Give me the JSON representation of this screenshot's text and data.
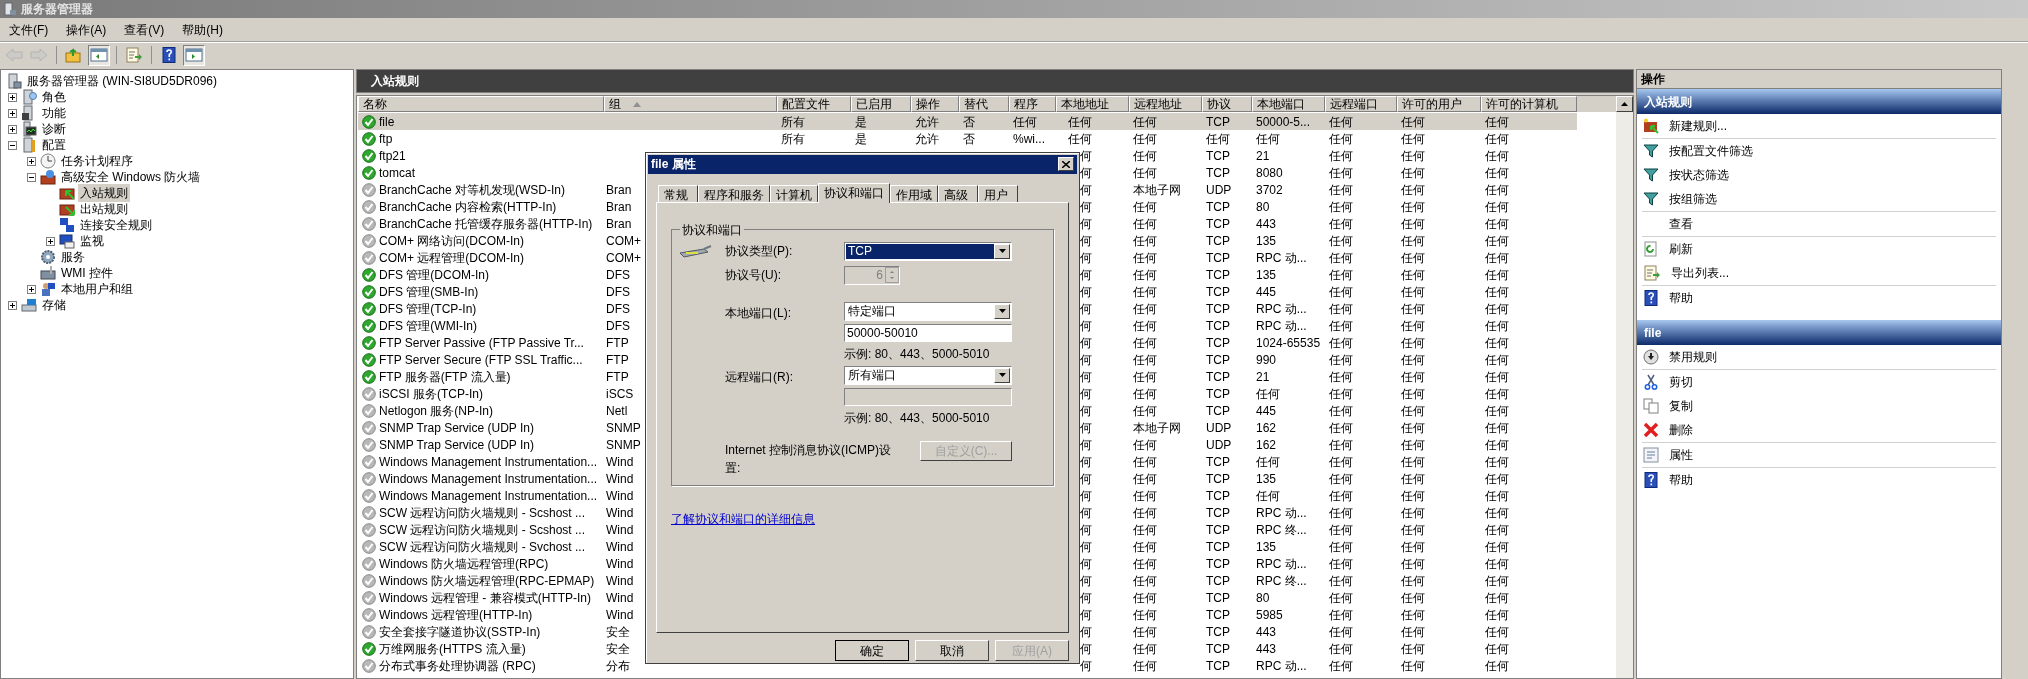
{
  "window": {
    "title": "服务器管理器"
  },
  "menu": [
    "文件(F)",
    "操作(A)",
    "查看(V)",
    "帮助(H)"
  ],
  "toolbar": [
    {
      "kind": "back",
      "disabled": true,
      "pressed": false
    },
    {
      "kind": "forward",
      "disabled": true,
      "pressed": false
    },
    {
      "kind": "up",
      "disabled": false,
      "pressed": false
    },
    {
      "kind": "tree",
      "disabled": false,
      "pressed": true
    },
    {
      "kind": "export",
      "disabled": false,
      "pressed": false
    },
    {
      "kind": "help",
      "disabled": false,
      "pressed": false
    },
    {
      "kind": "pane",
      "disabled": false,
      "pressed": true
    }
  ],
  "tree": {
    "label": "服务器管理器 (WIN-SI8UD5DR096)",
    "kind": "server",
    "selected": false,
    "children": [
      {
        "label": "角色",
        "kind": "roles",
        "expanded": false,
        "selected": false
      },
      {
        "label": "功能",
        "kind": "features",
        "expanded": false,
        "selected": false
      },
      {
        "label": "诊断",
        "kind": "diagnostics",
        "expanded": false,
        "selected": false
      },
      {
        "label": "配置",
        "kind": "config",
        "expanded": true,
        "selected": false,
        "children": [
          {
            "label": "任务计划程序",
            "kind": "scheduler",
            "expanded": false,
            "selected": false
          },
          {
            "label": "高级安全 Windows 防火墙",
            "kind": "firewall",
            "expanded": true,
            "selected": false,
            "children": [
              {
                "label": "入站规则",
                "kind": "inbound",
                "selected": true
              },
              {
                "label": "出站规则",
                "kind": "outbound",
                "selected": false
              },
              {
                "label": "连接安全规则",
                "kind": "connection",
                "selected": false
              },
              {
                "label": "监视",
                "kind": "monitor",
                "expanded": false,
                "selected": false
              }
            ]
          },
          {
            "label": "服务",
            "kind": "services",
            "selected": false
          },
          {
            "label": "WMI 控件",
            "kind": "wmi",
            "selected": false
          },
          {
            "label": "本地用户和组",
            "kind": "users",
            "expanded": false,
            "selected": false
          }
        ]
      },
      {
        "label": "存储",
        "kind": "storage",
        "expanded": false,
        "selected": false
      }
    ]
  },
  "rules": {
    "title": "入站规则",
    "columns": [
      {
        "label": "名称"
      },
      {
        "label": "组",
        "sorted": true
      },
      {
        "label": "配置文件"
      },
      {
        "label": "已启用"
      },
      {
        "label": "操作"
      },
      {
        "label": "替代"
      },
      {
        "label": "程序"
      },
      {
        "label": "本地地址"
      },
      {
        "label": "远程地址"
      },
      {
        "label": "协议"
      },
      {
        "label": "本地端口"
      },
      {
        "label": "远程端口"
      },
      {
        "label": "许可的用户"
      },
      {
        "label": "许可的计算机"
      }
    ],
    "rows": [
      {
        "name": "file",
        "enabled": true,
        "selected": true,
        "profile": "所有",
        "enabled_label": "是",
        "action": "允许",
        "override": "否",
        "program": "任何",
        "local_address": "任何",
        "remote_address": "任何",
        "protocol": "TCP",
        "local_port": "50000-5...",
        "remote_port": "任何",
        "allowed_users": "任何",
        "allowed_computers": "任何"
      },
      {
        "name": "ftp",
        "enabled": true,
        "selected": false,
        "profile": "所有",
        "enabled_label": "是",
        "action": "允许",
        "override": "否",
        "program": "%wi...",
        "local_address": "任何",
        "remote_address": "任何",
        "protocol": "任何",
        "local_port": "任何",
        "remote_port": "任何",
        "allowed_users": "任何",
        "allowed_computers": "任何"
      },
      {
        "name": "ftp21",
        "enabled": true,
        "selected": false,
        "local_address": "何",
        "remote_address": "任何",
        "protocol": "TCP",
        "local_port": "21",
        "remote_port": "任何",
        "allowed_users": "任何",
        "allowed_computers": "任何"
      },
      {
        "name": "tomcat",
        "enabled": true,
        "selected": false,
        "local_address": "何",
        "remote_address": "任何",
        "protocol": "TCP",
        "local_port": "8080",
        "remote_port": "任何",
        "allowed_users": "任何",
        "allowed_computers": "任何"
      },
      {
        "name": "BranchCache 对等机发现(WSD-In)",
        "enabled": false,
        "selected": false,
        "group": "Bran",
        "local_address": "何",
        "remote_address": "本地子网",
        "protocol": "UDP",
        "local_port": "3702",
        "remote_port": "任何",
        "allowed_users": "任何",
        "allowed_computers": "任何"
      },
      {
        "name": "BranchCache 内容检索(HTTP-In)",
        "enabled": false,
        "selected": false,
        "group": "Bran",
        "local_address": "何",
        "remote_address": "任何",
        "protocol": "TCP",
        "local_port": "80",
        "remote_port": "任何",
        "allowed_users": "任何",
        "allowed_computers": "任何"
      },
      {
        "name": "BranchCache 托管缓存服务器(HTTP-In)",
        "enabled": false,
        "selected": false,
        "group": "Bran",
        "local_address": "何",
        "remote_address": "任何",
        "protocol": "TCP",
        "local_port": "443",
        "remote_port": "任何",
        "allowed_users": "任何",
        "allowed_computers": "任何"
      },
      {
        "name": "COM+ 网络访问(DCOM-In)",
        "enabled": false,
        "selected": false,
        "group": "COM+",
        "local_address": "何",
        "remote_address": "任何",
        "protocol": "TCP",
        "local_port": "135",
        "remote_port": "任何",
        "allowed_users": "任何",
        "allowed_computers": "任何"
      },
      {
        "name": "COM+ 远程管理(DCOM-In)",
        "enabled": false,
        "selected": false,
        "group": "COM+",
        "local_address": "何",
        "remote_address": "任何",
        "protocol": "TCP",
        "local_port": "RPC 动...",
        "remote_port": "任何",
        "allowed_users": "任何",
        "allowed_computers": "任何"
      },
      {
        "name": "DFS 管理(DCOM-In)",
        "enabled": true,
        "selected": false,
        "group": "DFS",
        "local_address": "何",
        "remote_address": "任何",
        "protocol": "TCP",
        "local_port": "135",
        "remote_port": "任何",
        "allowed_users": "任何",
        "allowed_computers": "任何"
      },
      {
        "name": "DFS 管理(SMB-In)",
        "enabled": true,
        "selected": false,
        "group": "DFS",
        "local_address": "何",
        "remote_address": "任何",
        "protocol": "TCP",
        "local_port": "445",
        "remote_port": "任何",
        "allowed_users": "任何",
        "allowed_computers": "任何"
      },
      {
        "name": "DFS 管理(TCP-In)",
        "enabled": true,
        "selected": false,
        "group": "DFS",
        "local_address": "何",
        "remote_address": "任何",
        "protocol": "TCP",
        "local_port": "RPC 动...",
        "remote_port": "任何",
        "allowed_users": "任何",
        "allowed_computers": "任何"
      },
      {
        "name": "DFS 管理(WMI-In)",
        "enabled": true,
        "selected": false,
        "group": "DFS",
        "local_address": "何",
        "remote_address": "任何",
        "protocol": "TCP",
        "local_port": "RPC 动...",
        "remote_port": "任何",
        "allowed_users": "任何",
        "allowed_computers": "任何"
      },
      {
        "name": "FTP Server Passive (FTP Passive Tr...",
        "enabled": true,
        "selected": false,
        "group": "FTP",
        "local_address": "何",
        "remote_address": "任何",
        "protocol": "TCP",
        "local_port": "1024-65535",
        "remote_port": "任何",
        "allowed_users": "任何",
        "allowed_computers": "任何"
      },
      {
        "name": "FTP Server Secure (FTP SSL Traffic...",
        "enabled": true,
        "selected": false,
        "group": "FTP",
        "local_address": "何",
        "remote_address": "任何",
        "protocol": "TCP",
        "local_port": "990",
        "remote_port": "任何",
        "allowed_users": "任何",
        "allowed_computers": "任何"
      },
      {
        "name": "FTP 服务器(FTP 流入量)",
        "enabled": true,
        "selected": false,
        "group": "FTP",
        "local_address": "何",
        "remote_address": "任何",
        "protocol": "TCP",
        "local_port": "21",
        "remote_port": "任何",
        "allowed_users": "任何",
        "allowed_computers": "任何"
      },
      {
        "name": "iSCSI 服务(TCP-In)",
        "enabled": false,
        "selected": false,
        "group": "iSCS",
        "local_address": "何",
        "remote_address": "任何",
        "protocol": "TCP",
        "local_port": "任何",
        "remote_port": "任何",
        "allowed_users": "任何",
        "allowed_computers": "任何"
      },
      {
        "name": "Netlogon 服务(NP-In)",
        "enabled": false,
        "selected": false,
        "group": "Netl",
        "local_address": "何",
        "remote_address": "任何",
        "protocol": "TCP",
        "local_port": "445",
        "remote_port": "任何",
        "allowed_users": "任何",
        "allowed_computers": "任何"
      },
      {
        "name": "SNMP Trap Service (UDP In)",
        "enabled": false,
        "selected": false,
        "group": "SNMP",
        "local_address": "何",
        "remote_address": "本地子网",
        "protocol": "UDP",
        "local_port": "162",
        "remote_port": "任何",
        "allowed_users": "任何",
        "allowed_computers": "任何"
      },
      {
        "name": "SNMP Trap Service (UDP In)",
        "enabled": false,
        "selected": false,
        "group": "SNMP",
        "local_address": "何",
        "remote_address": "任何",
        "protocol": "UDP",
        "local_port": "162",
        "remote_port": "任何",
        "allowed_users": "任何",
        "allowed_computers": "任何"
      },
      {
        "name": "Windows Management Instrumentation...",
        "enabled": false,
        "selected": false,
        "group": "Wind",
        "local_address": "何",
        "remote_address": "任何",
        "protocol": "TCP",
        "local_port": "任何",
        "remote_port": "任何",
        "allowed_users": "任何",
        "allowed_computers": "任何"
      },
      {
        "name": "Windows Management Instrumentation...",
        "enabled": false,
        "selected": false,
        "group": "Wind",
        "local_address": "何",
        "remote_address": "任何",
        "protocol": "TCP",
        "local_port": "135",
        "remote_port": "任何",
        "allowed_users": "任何",
        "allowed_computers": "任何"
      },
      {
        "name": "Windows Management Instrumentation...",
        "enabled": false,
        "selected": false,
        "group": "Wind",
        "local_address": "何",
        "remote_address": "任何",
        "protocol": "TCP",
        "local_port": "任何",
        "remote_port": "任何",
        "allowed_users": "任何",
        "allowed_computers": "任何"
      },
      {
        "name": "SCW 远程访问防火墙规则 - Scshost ...",
        "enabled": false,
        "selected": false,
        "group": "Wind",
        "local_address": "何",
        "remote_address": "任何",
        "protocol": "TCP",
        "local_port": "RPC 动...",
        "remote_port": "任何",
        "allowed_users": "任何",
        "allowed_computers": "任何"
      },
      {
        "name": "SCW 远程访问防火墙规则 - Scshost ...",
        "enabled": false,
        "selected": false,
        "group": "Wind",
        "local_address": "何",
        "remote_address": "任何",
        "protocol": "TCP",
        "local_port": "RPC 终...",
        "remote_port": "任何",
        "allowed_users": "任何",
        "allowed_computers": "任何"
      },
      {
        "name": "SCW 远程访问防火墙规则 - Svchost ...",
        "enabled": false,
        "selected": false,
        "group": "Wind",
        "local_address": "何",
        "remote_address": "任何",
        "protocol": "TCP",
        "local_port": "135",
        "remote_port": "任何",
        "allowed_users": "任何",
        "allowed_computers": "任何"
      },
      {
        "name": "Windows 防火墙远程管理(RPC)",
        "enabled": false,
        "selected": false,
        "group": "Wind",
        "local_address": "何",
        "remote_address": "任何",
        "protocol": "TCP",
        "local_port": "RPC 动...",
        "remote_port": "任何",
        "allowed_users": "任何",
        "allowed_computers": "任何"
      },
      {
        "name": "Windows 防火墙远程管理(RPC-EPMAP)",
        "enabled": false,
        "selected": false,
        "group": "Wind",
        "local_address": "何",
        "remote_address": "任何",
        "protocol": "TCP",
        "local_port": "RPC 终...",
        "remote_port": "任何",
        "allowed_users": "任何",
        "allowed_computers": "任何"
      },
      {
        "name": "Windows 远程管理 - 兼容模式(HTTP-In)",
        "enabled": false,
        "selected": false,
        "group": "Wind",
        "local_address": "何",
        "remote_address": "任何",
        "protocol": "TCP",
        "local_port": "80",
        "remote_port": "任何",
        "allowed_users": "任何",
        "allowed_computers": "任何"
      },
      {
        "name": "Windows 远程管理(HTTP-In)",
        "enabled": false,
        "selected": false,
        "group": "Wind",
        "local_address": "何",
        "remote_address": "任何",
        "protocol": "TCP",
        "local_port": "5985",
        "remote_port": "任何",
        "allowed_users": "任何",
        "allowed_computers": "任何"
      },
      {
        "name": "安全套接字隧道协议(SSTP-In)",
        "enabled": false,
        "selected": false,
        "group": "安全",
        "local_address": "何",
        "remote_address": "任何",
        "protocol": "TCP",
        "local_port": "443",
        "remote_port": "任何",
        "allowed_users": "任何",
        "allowed_computers": "任何"
      },
      {
        "name": "万维网服务(HTTPS 流入量)",
        "enabled": true,
        "selected": false,
        "group": "安全",
        "local_address": "何",
        "remote_address": "任何",
        "protocol": "TCP",
        "local_port": "443",
        "remote_port": "任何",
        "allowed_users": "任何",
        "allowed_computers": "任何"
      },
      {
        "name": "分布式事务处理协调器 (RPC)",
        "enabled": false,
        "selected": false,
        "group": "分布",
        "local_address": "何",
        "remote_address": "任何",
        "protocol": "TCP",
        "local_port": "RPC 动...",
        "remote_port": "任何",
        "allowed_users": "任何",
        "allowed_computers": "任何"
      }
    ]
  },
  "dialog": {
    "title": "file 属性",
    "tabs": [
      {
        "label": "常规",
        "selected": false
      },
      {
        "label": "程序和服务",
        "selected": false
      },
      {
        "label": "计算机",
        "selected": false
      },
      {
        "label": "协议和端口",
        "selected": true
      },
      {
        "label": "作用域",
        "selected": false
      },
      {
        "label": "高级",
        "selected": false
      },
      {
        "label": "用户",
        "selected": false
      }
    ],
    "group_title": "协议和端口",
    "protocol_type": {
      "label": "协议类型(P):",
      "value": "TCP"
    },
    "protocol_number": {
      "label": "协议号(U):",
      "value": "6",
      "disabled": true
    },
    "local_port": {
      "label": "本地端口(L):",
      "value": "特定端口",
      "ports": "50000-50010",
      "ports_disabled": false,
      "example": "示例: 80、443、5000-5010"
    },
    "remote_port": {
      "label": "远程端口(R):",
      "value": "所有端口",
      "ports_disabled": true,
      "example": "示例: 80、443、5000-5010"
    },
    "icmp": {
      "label": "Internet 控制消息协议(ICMP)设置:",
      "button": "自定义(C)...",
      "disabled": true
    },
    "link": "了解协议和端口的详细信息",
    "buttons": [
      {
        "label": "确定",
        "default": true,
        "disabled": false
      },
      {
        "label": "取消",
        "default": false,
        "disabled": false
      },
      {
        "label": "应用(A)",
        "default": false,
        "disabled": true
      }
    ]
  },
  "actions": {
    "title": "操作",
    "sections": [
      {
        "title": "入站规则",
        "groups": [
          [
            {
              "label": "新建规则...",
              "kind": "new_rule"
            }
          ],
          [
            {
              "label": "按配置文件筛选",
              "kind": "filter"
            },
            {
              "label": "按状态筛选",
              "kind": "filter"
            },
            {
              "label": "按组筛选",
              "kind": "filter"
            }
          ],
          [
            {
              "label": "查看",
              "kind": "plain"
            }
          ],
          [
            {
              "label": "刷新",
              "kind": "refresh"
            },
            {
              "label": "导出列表...",
              "kind": "export"
            }
          ],
          [
            {
              "label": "帮助",
              "kind": "help"
            }
          ]
        ]
      },
      {
        "title": "file",
        "groups": [
          [
            {
              "label": "禁用规则",
              "kind": "disable"
            }
          ],
          [
            {
              "label": "剪切",
              "kind": "cut"
            },
            {
              "label": "复制",
              "kind": "copy"
            },
            {
              "label": "删除",
              "kind": "delete"
            }
          ],
          [
            {
              "label": "属性",
              "kind": "properties"
            }
          ],
          [
            {
              "label": "帮助",
              "kind": "help"
            }
          ]
        ]
      }
    ]
  }
}
